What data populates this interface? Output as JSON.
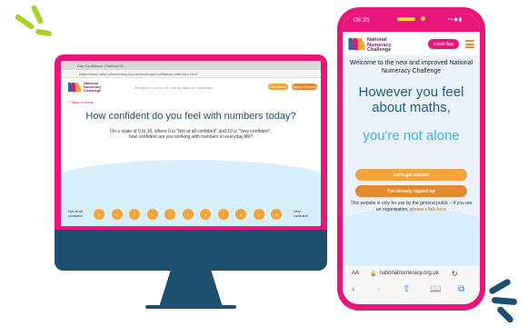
{
  "colors": {
    "magenta": "#e8157a",
    "navy": "#1d4f6e",
    "orange": "#f2a33a",
    "sky": "#3ab1e6",
    "logo_purple": "#6d1f5e"
  },
  "desktop": {
    "browser_tab": "Day Confidence | National N...",
    "url": "https://www.nationalnumeracy.org.uk/challenge/confidence-rate-intro.html",
    "header": {
      "logo_text": "National Numeracy Challenge",
      "tagline": "Brought to you by UK charity National Numeracy",
      "cta1": "Get started",
      "cta2": "Sign in / Register"
    },
    "back_link": "< Back to home",
    "title": "How confident do you feel with numbers today?",
    "description": "On a scale of 0 to 10, where 0 is \"Not at all confident\" and 10 is \"Very confident\", how confident are you working with numbers in everyday life?",
    "scale": {
      "left_label": "Not at all confident",
      "right_label": "Very confident",
      "options": [
        "0",
        "1",
        "2",
        "3",
        "4",
        "5",
        "6",
        "7",
        "8",
        "9",
        "10"
      ]
    }
  },
  "phone": {
    "time": "08:35",
    "logo_text": "National Numeracy Challenge",
    "install_button": "Install App",
    "welcome": "Welcome to the new and improved National Numeracy Challenge",
    "heading": "However you feel about maths,",
    "subheading": "you're not alone",
    "primary_button": "Let's get started",
    "secondary_button": "I've already signed up",
    "info": "This website is only for use by the general public – if you are an organisation,",
    "info_link": "please click here",
    "address_aa": "AA",
    "address_domain": "nationalnumeracy.org.uk",
    "icons": [
      "lock-icon",
      "reload-icon",
      "back-icon",
      "forward-icon",
      "share-icon",
      "bookmarks-icon",
      "tabs-icon"
    ]
  }
}
